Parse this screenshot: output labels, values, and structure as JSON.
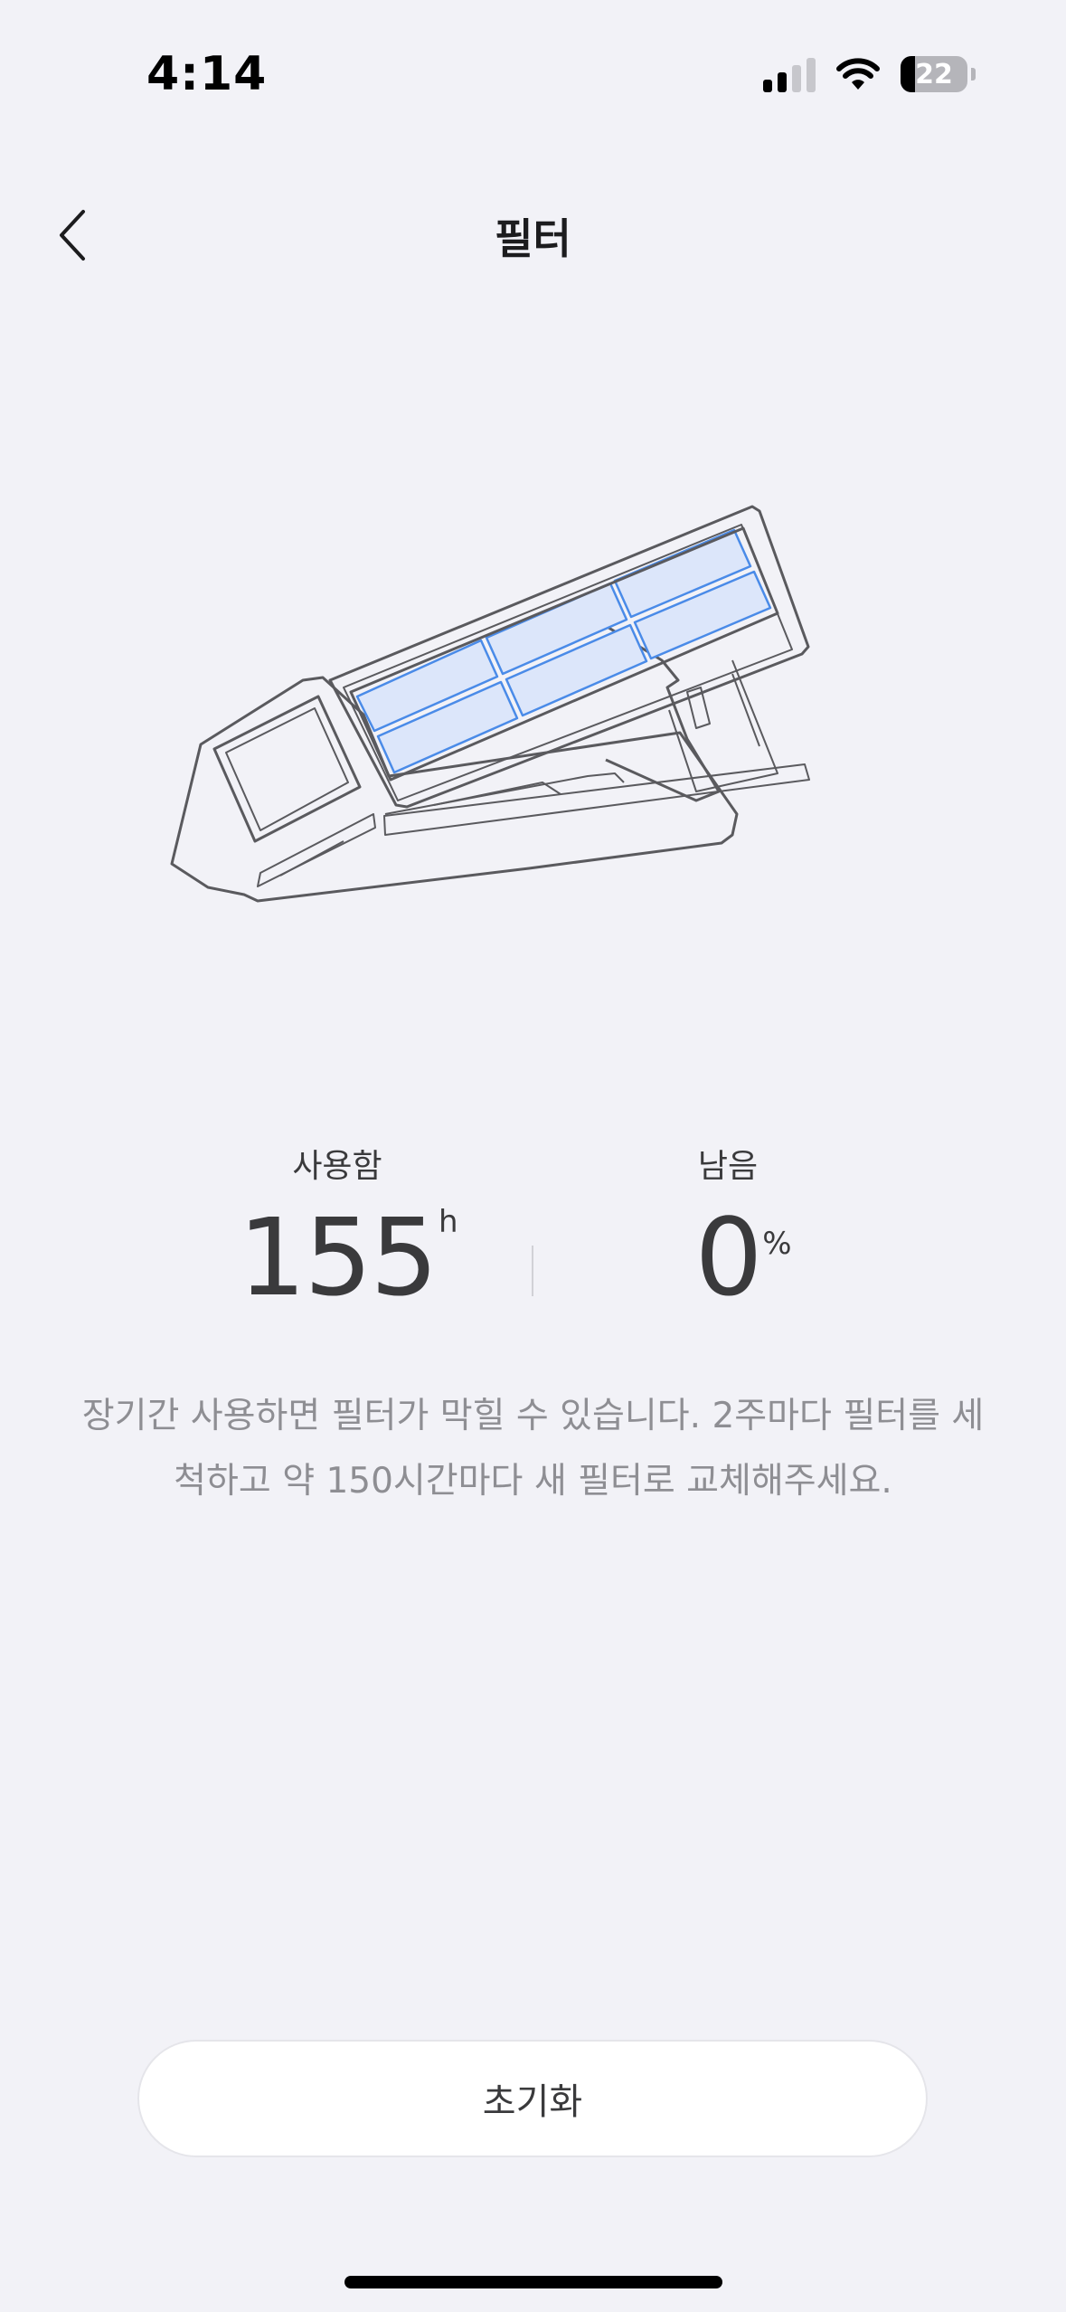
{
  "status_bar": {
    "time": "4:14",
    "battery_level": "22",
    "signal_bars_active": 2,
    "signal_bars_total": 4
  },
  "nav": {
    "title": "필터",
    "back_icon": "chevron-left-icon"
  },
  "stats": {
    "used": {
      "label": "사용함",
      "value": "155",
      "unit": "h"
    },
    "remaining": {
      "label": "남음",
      "value": "0",
      "unit": "%"
    }
  },
  "description": "장기간 사용하면 필터가 막힐 수 있습니다. 2주마다 필터를 세척하고 약 150시간마다 새 필터로 교체해주세요.",
  "reset_button": {
    "label": "초기화"
  },
  "colors": {
    "background": "#f2f2f7",
    "filter_fill": "#dce6fa",
    "filter_stroke": "#4a8be8",
    "outline": "#5a5a5e"
  }
}
